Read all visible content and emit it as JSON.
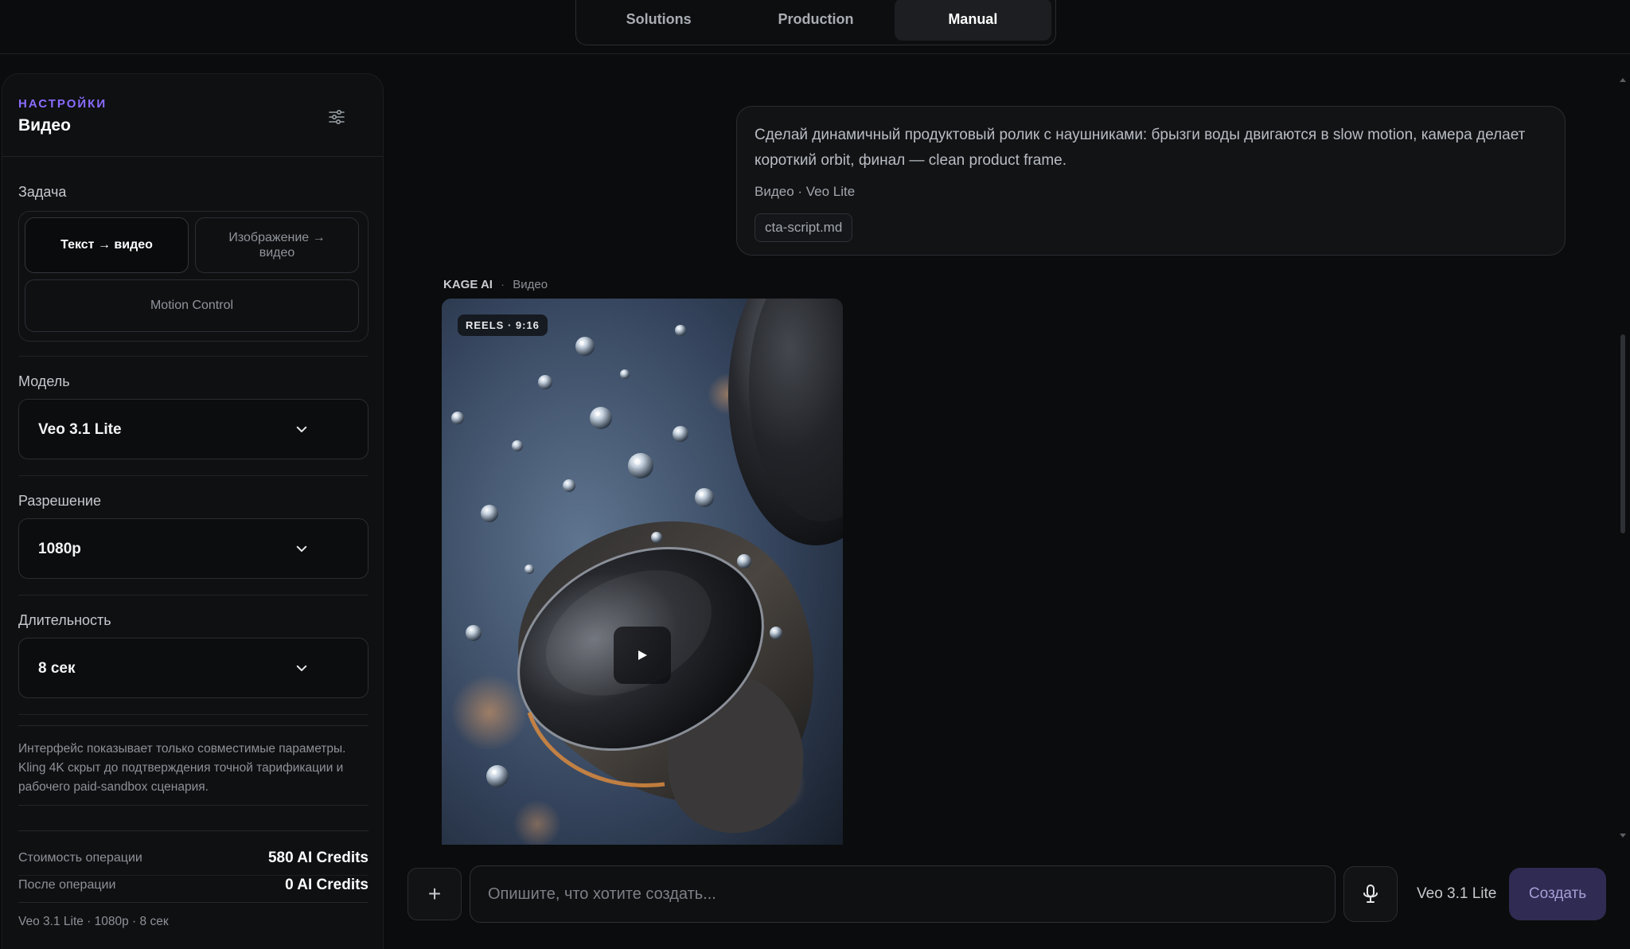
{
  "nav": {
    "tabs": [
      {
        "label": "Solutions"
      },
      {
        "label": "Production"
      },
      {
        "label": "Manual"
      }
    ],
    "active_tab": "Manual"
  },
  "sidebar": {
    "eyebrow": "НАСТРОЙКИ",
    "title": "Видео",
    "task": {
      "label": "Задача",
      "options": [
        "Текст → видео",
        "Изображение → видео",
        "Motion Control"
      ],
      "selected": "Текст → видео"
    },
    "model": {
      "label": "Модель",
      "value": "Veo 3.1 Lite"
    },
    "resolution": {
      "label": "Разрешение",
      "value": "1080p"
    },
    "duration": {
      "label": "Длительность",
      "value": "8 сек"
    },
    "note": "Интерфейс показывает только совместимые параметры. Kling 4K скрыт до подтверждения точной тарификации и рабочего paid-sandbox сценария.",
    "cost": {
      "label": "Стоимость операции",
      "value": "580 AI Credits"
    },
    "after": {
      "label": "После операции",
      "value": "0 AI Credits"
    },
    "summary": "Veo 3.1 Lite · 1080p · 8 сек"
  },
  "chat": {
    "user_message": {
      "text": "Сделай динамичный продуктовый ролик с наушниками: брызги воды двигаются в slow motion, камера делает короткий orbit, финал — clean product frame.",
      "meta": "Видео · Veo Lite",
      "attachment": "cta-script.md"
    },
    "assistant": {
      "name": "KAGE AI",
      "separator": "·",
      "kind": "Видео",
      "media_badge": "REELS · 9:16"
    }
  },
  "composer": {
    "plus_label": "+",
    "placeholder": "Опишите, что хотите создать...",
    "model": "Veo 3.1 Lite",
    "submit_label": "Создать"
  }
}
